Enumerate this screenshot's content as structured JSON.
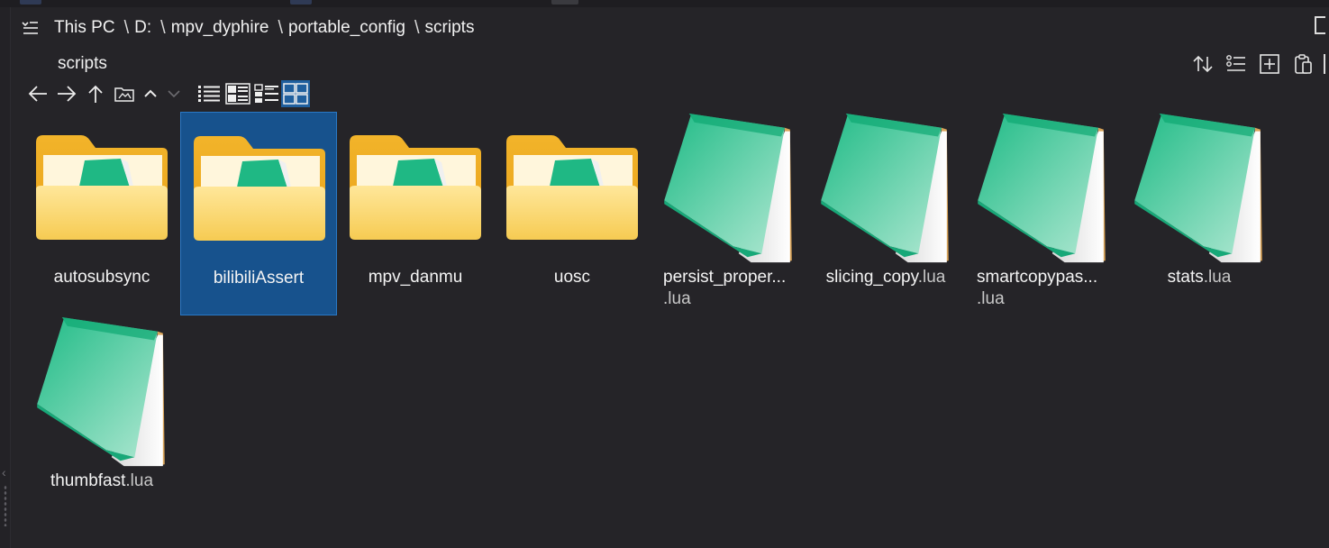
{
  "breadcrumb": {
    "items": [
      "This PC",
      "D:",
      "mpv_dyphire",
      "portable_config",
      "scripts"
    ]
  },
  "folder_title": "scripts",
  "navigation": {
    "back_icon": "arrow-left-icon",
    "forward_icon": "arrow-right-icon",
    "up_icon": "arrow-up-icon",
    "folder_icon": "open-folder-icon",
    "collapse_icon": "chevron-up-icon",
    "expand_icon": "chevron-down-icon"
  },
  "view_modes": [
    "list-view-icon",
    "details-view-icon",
    "tiles-view-icon",
    "large-icons-view-icon"
  ],
  "active_view": "large-icons-view-icon",
  "right_tools": [
    "sort-icon",
    "group-icon",
    "new-item-icon",
    "clipboard-icon"
  ],
  "selected_item": "bilibiliAssert",
  "files": [
    {
      "name": "autosubsync",
      "ext": "",
      "type": "folder"
    },
    {
      "name": "bilibiliAssert",
      "ext": "",
      "type": "folder"
    },
    {
      "name": "mpv_danmu",
      "ext": "",
      "type": "folder"
    },
    {
      "name": "uosc",
      "ext": "",
      "type": "folder"
    },
    {
      "name": "persist_proper...",
      "ext": ".lua",
      "type": "lua",
      "wrap": true
    },
    {
      "name": "slicing_copy",
      "ext": ".lua",
      "type": "lua"
    },
    {
      "name": "smartcopypas...",
      "ext": ".lua",
      "type": "lua",
      "wrap": true
    },
    {
      "name": "stats",
      "ext": ".lua",
      "type": "lua"
    },
    {
      "name": "thumbfast",
      "ext": ".lua",
      "type": "lua"
    }
  ],
  "colors": {
    "background": "#252428",
    "selection": "#17528d",
    "selection_border": "#2a79c6",
    "folder_yellow": "#f6c94a",
    "lua_teal": "#2bbf8e"
  }
}
